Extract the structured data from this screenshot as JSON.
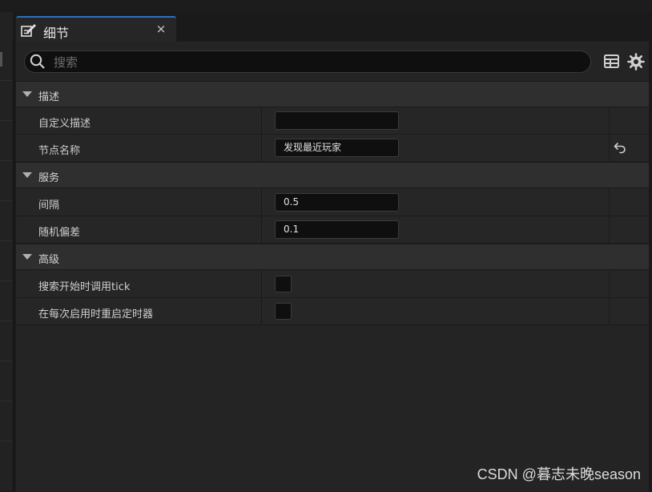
{
  "tab": {
    "title": "细节",
    "close_glyph": "×",
    "icon": "pencil-note-icon"
  },
  "search": {
    "placeholder": "搜索",
    "value": ""
  },
  "toolbar": {
    "table_icon": "table-view-icon",
    "settings_icon": "gear-icon"
  },
  "sections": [
    {
      "label": "描述",
      "rows": [
        {
          "name": "自定义描述",
          "type": "text",
          "value": ""
        },
        {
          "name": "节点名称",
          "type": "text",
          "value": "发现最近玩家",
          "reset": true
        }
      ]
    },
    {
      "label": "服务",
      "rows": [
        {
          "name": "间隔",
          "type": "text",
          "value": "0.5"
        },
        {
          "name": "随机偏差",
          "type": "text",
          "value": "0.1"
        }
      ]
    },
    {
      "label": "高级",
      "rows": [
        {
          "name": "搜索开始时调用tick",
          "type": "checkbox",
          "checked": false
        },
        {
          "name": "在每次启用时重启定时器",
          "type": "checkbox",
          "checked": false
        }
      ]
    }
  ],
  "watermark": "CSDN @暮志未晚season",
  "colors": {
    "accent": "#2f6fbf",
    "panel": "#242424",
    "section": "#2f2f2f"
  }
}
